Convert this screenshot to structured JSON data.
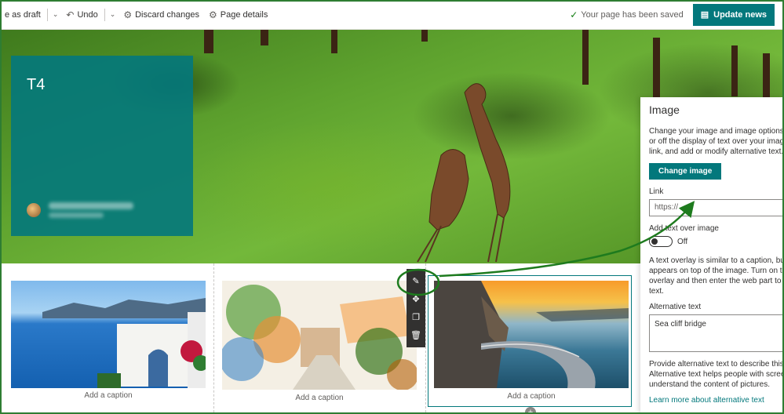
{
  "toolbar": {
    "save_draft_label": "e as draft",
    "undo_label": "Undo",
    "discard_label": "Discard changes",
    "page_details_label": "Page details",
    "status_text": "Your page has been saved",
    "update_label": "Update news"
  },
  "hero": {
    "title": "T4"
  },
  "gallery": {
    "captions": [
      "Add a caption",
      "Add a caption",
      "Add a caption"
    ]
  },
  "pane": {
    "title": "Image",
    "description_lines": [
      "Change your image and image options. Tu",
      "or off the display of text over your image,",
      "link, and add or modify alternative text."
    ],
    "change_image_label": "Change image",
    "link_label": "Link",
    "link_placeholder": "https://",
    "text_over_label": "Add text over image",
    "toggle_state": "Off",
    "overlay_lines": [
      "A text overlay is similar to a caption, but it",
      "appears on top of the image. Turn on text",
      "overlay and then enter the web part to ed",
      "text."
    ],
    "alt_label": "Alternative text",
    "alt_value": "Sea cliff bridge",
    "help_lines": [
      "Provide alternative text to describe this im",
      "Alternative text helps people with screen r",
      "understand the content of pictures."
    ],
    "learn_more": "Learn more about alternative text"
  },
  "colors": {
    "accent": "#03787c",
    "annotation": "#1e7b1e"
  },
  "icons": [
    "chevron-down-icon",
    "undo-icon",
    "discard-icon",
    "gear-icon",
    "check-icon",
    "news-icon",
    "edit-icon",
    "move-icon",
    "duplicate-icon",
    "delete-icon",
    "add-icon"
  ]
}
